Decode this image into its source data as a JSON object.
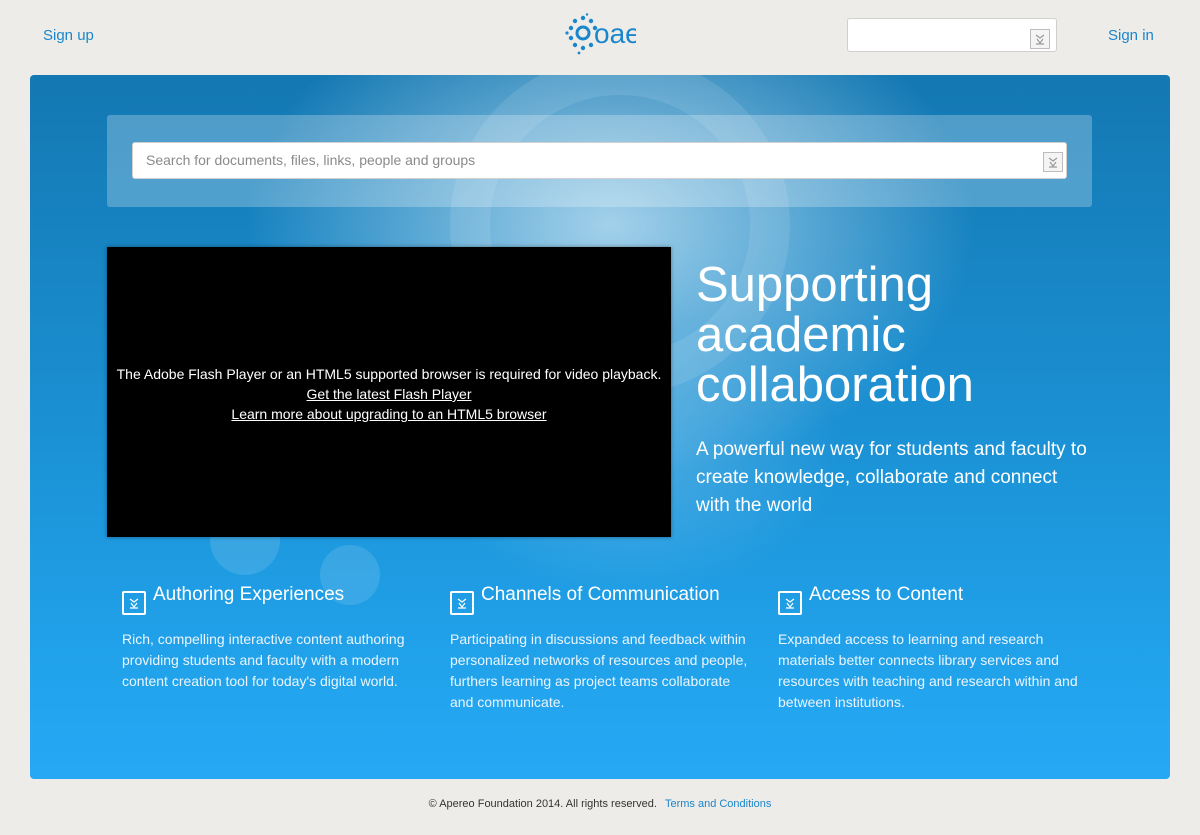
{
  "header": {
    "signup_label": "Sign up",
    "signin_label": "Sign in",
    "logo_text": "oae",
    "search_value": ""
  },
  "search": {
    "placeholder": "Search for documents, files, links, people and groups"
  },
  "video": {
    "message": "The Adobe Flash Player or an HTML5 supported browser is required for video playback.",
    "flash_link": "Get the latest Flash Player",
    "html5_link": "Learn more about upgrading to an HTML5 browser"
  },
  "hero": {
    "headline": "Supporting academic collaboration",
    "subheadline": "A powerful new way for students and faculty to create knowledge, collaborate and connect with the world"
  },
  "features": [
    {
      "title": "Authoring Experiences",
      "description": "Rich, compelling interactive content authoring providing students and faculty with a modern content creation tool for today's digital world.",
      "icon": "broken-image-icon"
    },
    {
      "title": "Channels of Communication",
      "description": "Participating in discussions and feedback within personalized networks of resources and people, furthers learning as project teams collaborate and communicate.",
      "icon": "broken-image-icon"
    },
    {
      "title": "Access to Content",
      "description": "Expanded access to learning and research materials better connects library services and resources with teaching and research within and between institutions.",
      "icon": "broken-image-icon"
    }
  ],
  "footer": {
    "copyright": "© Apereo Foundation 2014. All rights reserved.",
    "terms_label": "Terms and Conditions"
  },
  "colors": {
    "page_bg": "#edece8",
    "link": "#1a86cc",
    "hero_top": "#1478b2",
    "hero_bottom": "#26a8f5"
  }
}
